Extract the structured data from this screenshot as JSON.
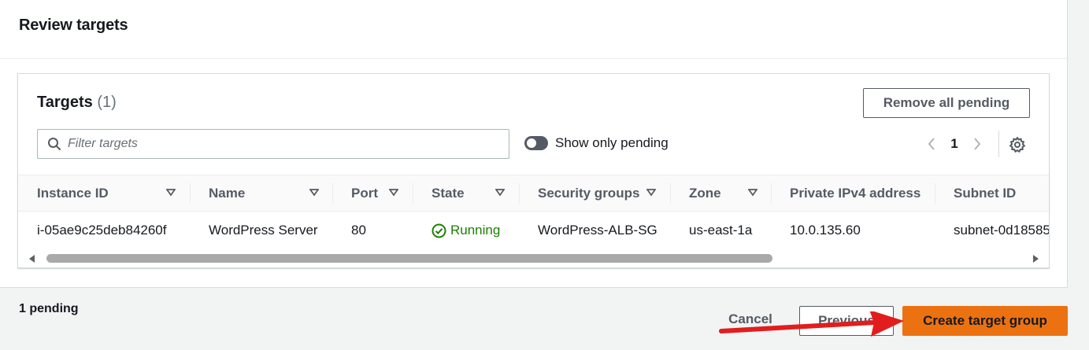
{
  "review": {
    "title": "Review targets"
  },
  "targets": {
    "title": "Targets",
    "count": "(1)",
    "remove_all_label": "Remove all pending",
    "filter_placeholder": "Filter targets",
    "toggle_label": "Show only pending",
    "toggle_on": false,
    "page": "1"
  },
  "table": {
    "columns": [
      "Instance ID",
      "Name",
      "Port",
      "State",
      "Security groups",
      "Zone",
      "Private IPv4 address",
      "Subnet ID"
    ],
    "rows": [
      {
        "instance_id": "i-05ae9c25deb84260f",
        "name": "WordPress Server",
        "port": "80",
        "state": "Running",
        "security_groups": "WordPress-ALB-SG",
        "zone": "us-east-1a",
        "private_ip": "10.0.135.60",
        "subnet_id": "subnet-0d18585"
      }
    ]
  },
  "footer": {
    "pending": "1 pending",
    "cancel_label": "Cancel",
    "previous_label": "Previous",
    "create_label": "Create target group"
  },
  "icons": {
    "search": "search-icon",
    "settings": "gear-icon",
    "prev_page": "chevron-left-icon",
    "next_page": "chevron-right-icon",
    "sort": "caret-down-icon",
    "status": "check-circle-icon",
    "annotation": "red-arrow-icon"
  },
  "colors": {
    "primary": "#ec7211",
    "success": "#1d8102",
    "annotation": "#e11d1d"
  }
}
